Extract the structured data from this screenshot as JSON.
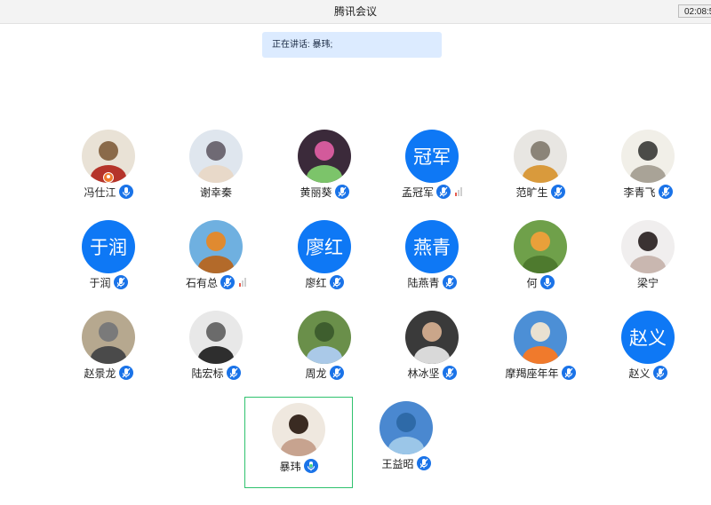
{
  "window": {
    "title": "腾讯会议",
    "clock": "02:08:5"
  },
  "speaking": {
    "label": "正在讲话: 暴玮;"
  },
  "participants": [
    {
      "name": "冯仕江",
      "avatar": {
        "type": "photo",
        "icon": "photo-avatar"
      },
      "mic": "unmuted",
      "host": true
    },
    {
      "name": "谢幸秦",
      "avatar": {
        "type": "photo",
        "icon": "photo-avatar"
      },
      "mic": "none"
    },
    {
      "name": "黄丽葵",
      "avatar": {
        "type": "photo",
        "icon": "photo-avatar"
      },
      "mic": "muted"
    },
    {
      "name": "孟冠军",
      "avatar": {
        "type": "text",
        "text": "冠军"
      },
      "mic": "muted",
      "signal": 1
    },
    {
      "name": "范旷生",
      "avatar": {
        "type": "photo",
        "icon": "photo-avatar"
      },
      "mic": "muted"
    },
    {
      "name": "李青飞",
      "avatar": {
        "type": "photo",
        "icon": "photo-avatar"
      },
      "mic": "muted"
    },
    {
      "name": "于润",
      "avatar": {
        "type": "text",
        "text": "于润"
      },
      "mic": "muted"
    },
    {
      "name": "石有总",
      "avatar": {
        "type": "photo",
        "icon": "photo-avatar"
      },
      "mic": "muted",
      "signal": 1
    },
    {
      "name": "廖红",
      "avatar": {
        "type": "text",
        "text": "廖红"
      },
      "mic": "muted"
    },
    {
      "name": "陆燕青",
      "avatar": {
        "type": "text",
        "text": "燕青"
      },
      "mic": "muted"
    },
    {
      "name": "何",
      "avatar": {
        "type": "photo",
        "icon": "photo-avatar"
      },
      "mic": "unmuted"
    },
    {
      "name": "梁宁",
      "avatar": {
        "type": "photo",
        "icon": "photo-avatar"
      },
      "mic": "none"
    },
    {
      "name": "赵景龙",
      "avatar": {
        "type": "photo",
        "icon": "photo-avatar"
      },
      "mic": "muted"
    },
    {
      "name": "陆宏标",
      "avatar": {
        "type": "photo",
        "icon": "photo-avatar"
      },
      "mic": "muted"
    },
    {
      "name": "周龙",
      "avatar": {
        "type": "photo",
        "icon": "photo-avatar"
      },
      "mic": "muted"
    },
    {
      "name": "林冰坚",
      "avatar": {
        "type": "photo",
        "icon": "photo-avatar"
      },
      "mic": "muted"
    },
    {
      "name": "摩羯座年年",
      "avatar": {
        "type": "photo",
        "icon": "photo-avatar"
      },
      "mic": "muted"
    },
    {
      "name": "赵义",
      "avatar": {
        "type": "text",
        "text": "赵义"
      },
      "mic": "muted"
    },
    {
      "name": "暴玮",
      "avatar": {
        "type": "photo",
        "icon": "photo-avatar"
      },
      "mic": "talking",
      "active": true
    },
    {
      "name": "王益昭",
      "avatar": {
        "type": "photo",
        "icon": "photo-avatar"
      },
      "mic": "muted"
    }
  ],
  "colors": {
    "accent": "#1a73e8",
    "text_avatar_bg": "#0e78f5",
    "speaking_bg": "#dcebff",
    "active_border": "#2fc26e",
    "host_badge": "#f07a2c"
  }
}
